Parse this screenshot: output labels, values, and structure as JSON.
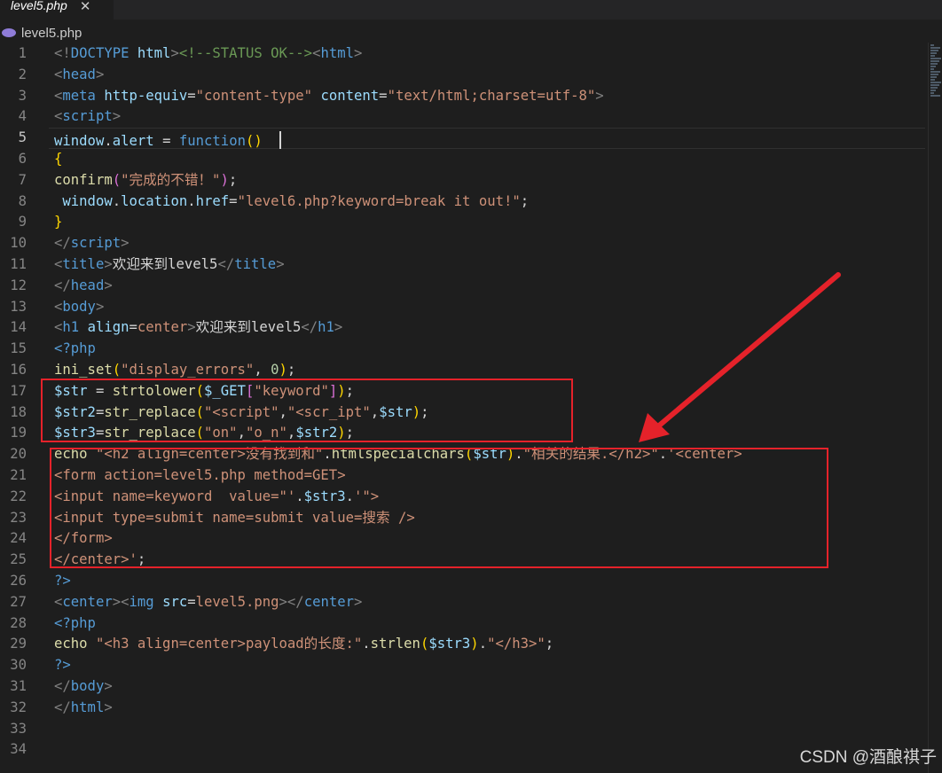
{
  "tab": {
    "title": "level5.php",
    "close_glyph": "✕"
  },
  "breadcrumb": {
    "icon": "php-file-icon",
    "label": "level5.php"
  },
  "editor": {
    "active_line": 5,
    "lines": [
      {
        "n": "1",
        "tokens": [
          [
            "<!",
            "t-punc"
          ],
          [
            "DOCTYPE",
            "t-tag"
          ],
          [
            " ",
            "t-txt"
          ],
          [
            "html",
            "t-attr"
          ],
          [
            ">",
            "t-punc"
          ],
          [
            "<!--STATUS OK-->",
            "t-com"
          ],
          [
            "<",
            "t-punc"
          ],
          [
            "html",
            "t-tag"
          ],
          [
            ">",
            "t-punc"
          ]
        ]
      },
      {
        "n": "2",
        "tokens": [
          [
            "<",
            "t-punc"
          ],
          [
            "head",
            "t-tag"
          ],
          [
            ">",
            "t-punc"
          ]
        ]
      },
      {
        "n": "3",
        "tokens": [
          [
            "<",
            "t-punc"
          ],
          [
            "meta",
            "t-tag"
          ],
          [
            " ",
            "t-txt"
          ],
          [
            "http-equiv",
            "t-attr"
          ],
          [
            "=",
            "t-txt"
          ],
          [
            "\"content-type\"",
            "t-str"
          ],
          [
            " ",
            "t-txt"
          ],
          [
            "content",
            "t-attr"
          ],
          [
            "=",
            "t-txt"
          ],
          [
            "\"text/html;charset=utf-8\"",
            "t-str"
          ],
          [
            ">",
            "t-punc"
          ]
        ]
      },
      {
        "n": "4",
        "tokens": [
          [
            "<",
            "t-punc"
          ],
          [
            "script",
            "t-tag"
          ],
          [
            ">",
            "t-punc"
          ]
        ]
      },
      {
        "n": "5",
        "tokens": [
          [
            "window",
            "t-var"
          ],
          [
            ".",
            "t-txt"
          ],
          [
            "alert",
            "t-var"
          ],
          [
            " = ",
            "t-txt"
          ],
          [
            "function",
            "t-kw"
          ],
          [
            "()",
            "t-br"
          ],
          [
            "  ",
            "t-txt"
          ]
        ]
      },
      {
        "n": "6",
        "tokens": [
          [
            "{",
            "t-br"
          ]
        ]
      },
      {
        "n": "7",
        "tokens": [
          [
            "confirm",
            "t-fn"
          ],
          [
            "(",
            "t-br2"
          ],
          [
            "\"完成的不错！\"",
            "t-str"
          ],
          [
            ")",
            "t-br2"
          ],
          [
            ";",
            "t-txt"
          ]
        ]
      },
      {
        "n": "8",
        "tokens": [
          [
            " window",
            "t-var"
          ],
          [
            ".",
            "t-txt"
          ],
          [
            "location",
            "t-var"
          ],
          [
            ".",
            "t-txt"
          ],
          [
            "href",
            "t-var"
          ],
          [
            "=",
            "t-txt"
          ],
          [
            "\"level6.php?keyword=break it out!\"",
            "t-str"
          ],
          [
            ";",
            "t-txt"
          ]
        ]
      },
      {
        "n": "9",
        "tokens": [
          [
            "}",
            "t-br"
          ]
        ]
      },
      {
        "n": "10",
        "tokens": [
          [
            "</",
            "t-punc"
          ],
          [
            "script",
            "t-tag"
          ],
          [
            ">",
            "t-punc"
          ]
        ]
      },
      {
        "n": "11",
        "tokens": [
          [
            "<",
            "t-punc"
          ],
          [
            "title",
            "t-tag"
          ],
          [
            ">",
            "t-punc"
          ],
          [
            "欢迎来到level5",
            "t-txt"
          ],
          [
            "</",
            "t-punc"
          ],
          [
            "title",
            "t-tag"
          ],
          [
            ">",
            "t-punc"
          ]
        ]
      },
      {
        "n": "12",
        "tokens": [
          [
            "</",
            "t-punc"
          ],
          [
            "head",
            "t-tag"
          ],
          [
            ">",
            "t-punc"
          ]
        ]
      },
      {
        "n": "13",
        "tokens": [
          [
            "<",
            "t-punc"
          ],
          [
            "body",
            "t-tag"
          ],
          [
            ">",
            "t-punc"
          ]
        ]
      },
      {
        "n": "14",
        "tokens": [
          [
            "<",
            "t-punc"
          ],
          [
            "h1",
            "t-tag"
          ],
          [
            " ",
            "t-txt"
          ],
          [
            "align",
            "t-attr"
          ],
          [
            "=",
            "t-txt"
          ],
          [
            "center",
            "t-str"
          ],
          [
            ">",
            "t-punc"
          ],
          [
            "欢迎来到level5",
            "t-txt"
          ],
          [
            "</",
            "t-punc"
          ],
          [
            "h1",
            "t-tag"
          ],
          [
            ">",
            "t-punc"
          ]
        ]
      },
      {
        "n": "15",
        "tokens": [
          [
            "<?php",
            "t-kw"
          ]
        ]
      },
      {
        "n": "16",
        "tokens": [
          [
            "ini_set",
            "t-fn"
          ],
          [
            "(",
            "t-br"
          ],
          [
            "\"display_errors\"",
            "t-str"
          ],
          [
            ", ",
            "t-txt"
          ],
          [
            "0",
            "t-num"
          ],
          [
            ")",
            "t-br"
          ],
          [
            ";",
            "t-txt"
          ]
        ]
      },
      {
        "n": "17",
        "tokens": [
          [
            "$str",
            "t-var"
          ],
          [
            " = ",
            "t-txt"
          ],
          [
            "strtolower",
            "t-fn"
          ],
          [
            "(",
            "t-br"
          ],
          [
            "$_GET",
            "t-var"
          ],
          [
            "[",
            "t-br2"
          ],
          [
            "\"keyword\"",
            "t-str"
          ],
          [
            "]",
            "t-br2"
          ],
          [
            ")",
            "t-br"
          ],
          [
            ";",
            "t-txt"
          ]
        ]
      },
      {
        "n": "18",
        "tokens": [
          [
            "$str2",
            "t-var"
          ],
          [
            "=",
            "t-txt"
          ],
          [
            "str_replace",
            "t-fn"
          ],
          [
            "(",
            "t-br"
          ],
          [
            "\"<script\"",
            "t-str"
          ],
          [
            ",",
            "t-txt"
          ],
          [
            "\"<scr_ipt\"",
            "t-str"
          ],
          [
            ",",
            "t-txt"
          ],
          [
            "$str",
            "t-var"
          ],
          [
            ")",
            "t-br"
          ],
          [
            ";",
            "t-txt"
          ]
        ]
      },
      {
        "n": "19",
        "tokens": [
          [
            "$str3",
            "t-var"
          ],
          [
            "=",
            "t-txt"
          ],
          [
            "str_replace",
            "t-fn"
          ],
          [
            "(",
            "t-br"
          ],
          [
            "\"on\"",
            "t-str"
          ],
          [
            ",",
            "t-txt"
          ],
          [
            "\"o_n\"",
            "t-str"
          ],
          [
            ",",
            "t-txt"
          ],
          [
            "$str2",
            "t-var"
          ],
          [
            ")",
            "t-br"
          ],
          [
            ";",
            "t-txt"
          ]
        ]
      },
      {
        "n": "20",
        "tokens": [
          [
            "echo",
            "t-fn"
          ],
          [
            " ",
            "t-txt"
          ],
          [
            "\"<h2 align=center>没有找到和\"",
            "t-str"
          ],
          [
            ".",
            "t-txt"
          ],
          [
            "htmlspecialchars",
            "t-fn"
          ],
          [
            "(",
            "t-br"
          ],
          [
            "$str",
            "t-var"
          ],
          [
            ")",
            "t-br"
          ],
          [
            ".",
            "t-txt"
          ],
          [
            "\"相关的结果.</h2>\"",
            "t-str"
          ],
          [
            ".",
            "t-txt"
          ],
          [
            "'<center>",
            "t-str"
          ]
        ]
      },
      {
        "n": "21",
        "tokens": [
          [
            "<form action=level5.php method=GET>",
            "t-str"
          ]
        ]
      },
      {
        "n": "22",
        "tokens": [
          [
            "<input name=keyword  value=\"'",
            "t-str"
          ],
          [
            ".",
            "t-txt"
          ],
          [
            "$str3",
            "t-var"
          ],
          [
            ".",
            "t-txt"
          ],
          [
            "'\">",
            "t-str"
          ]
        ]
      },
      {
        "n": "23",
        "tokens": [
          [
            "<input type=submit name=submit value=搜索 />",
            "t-str"
          ]
        ]
      },
      {
        "n": "24",
        "tokens": [
          [
            "</form>",
            "t-str"
          ]
        ]
      },
      {
        "n": "25",
        "tokens": [
          [
            "</center>'",
            "t-str"
          ],
          [
            ";",
            "t-txt"
          ]
        ]
      },
      {
        "n": "26",
        "tokens": [
          [
            "?>",
            "t-kw"
          ]
        ]
      },
      {
        "n": "27",
        "tokens": [
          [
            "<",
            "t-punc"
          ],
          [
            "center",
            "t-tag"
          ],
          [
            ">",
            "t-punc"
          ],
          [
            "<",
            "t-punc"
          ],
          [
            "img",
            "t-tag"
          ],
          [
            " ",
            "t-txt"
          ],
          [
            "src",
            "t-attr"
          ],
          [
            "=",
            "t-txt"
          ],
          [
            "level5.png",
            "t-str"
          ],
          [
            ">",
            "t-punc"
          ],
          [
            "</",
            "t-punc"
          ],
          [
            "center",
            "t-tag"
          ],
          [
            ">",
            "t-punc"
          ]
        ]
      },
      {
        "n": "28",
        "tokens": [
          [
            "<?php",
            "t-kw"
          ]
        ]
      },
      {
        "n": "29",
        "tokens": [
          [
            "echo",
            "t-fn"
          ],
          [
            " ",
            "t-txt"
          ],
          [
            "\"<h3 align=center>payload的长度:\"",
            "t-str"
          ],
          [
            ".",
            "t-txt"
          ],
          [
            "strlen",
            "t-fn"
          ],
          [
            "(",
            "t-br"
          ],
          [
            "$str3",
            "t-var"
          ],
          [
            ")",
            "t-br"
          ],
          [
            ".",
            "t-txt"
          ],
          [
            "\"</h3>\"",
            "t-str"
          ],
          [
            ";",
            "t-txt"
          ]
        ]
      },
      {
        "n": "30",
        "tokens": [
          [
            "?>",
            "t-kw"
          ]
        ]
      },
      {
        "n": "31",
        "tokens": [
          [
            "</",
            "t-punc"
          ],
          [
            "body",
            "t-tag"
          ],
          [
            ">",
            "t-punc"
          ]
        ]
      },
      {
        "n": "32",
        "tokens": [
          [
            "</",
            "t-punc"
          ],
          [
            "html",
            "t-tag"
          ],
          [
            ">",
            "t-punc"
          ]
        ]
      },
      {
        "n": "33",
        "tokens": []
      },
      {
        "n": "34",
        "tokens": []
      }
    ]
  },
  "annotations": {
    "highlight_color": "#e5222a"
  },
  "watermark": {
    "text": "CSDN @酒酿祺子"
  }
}
